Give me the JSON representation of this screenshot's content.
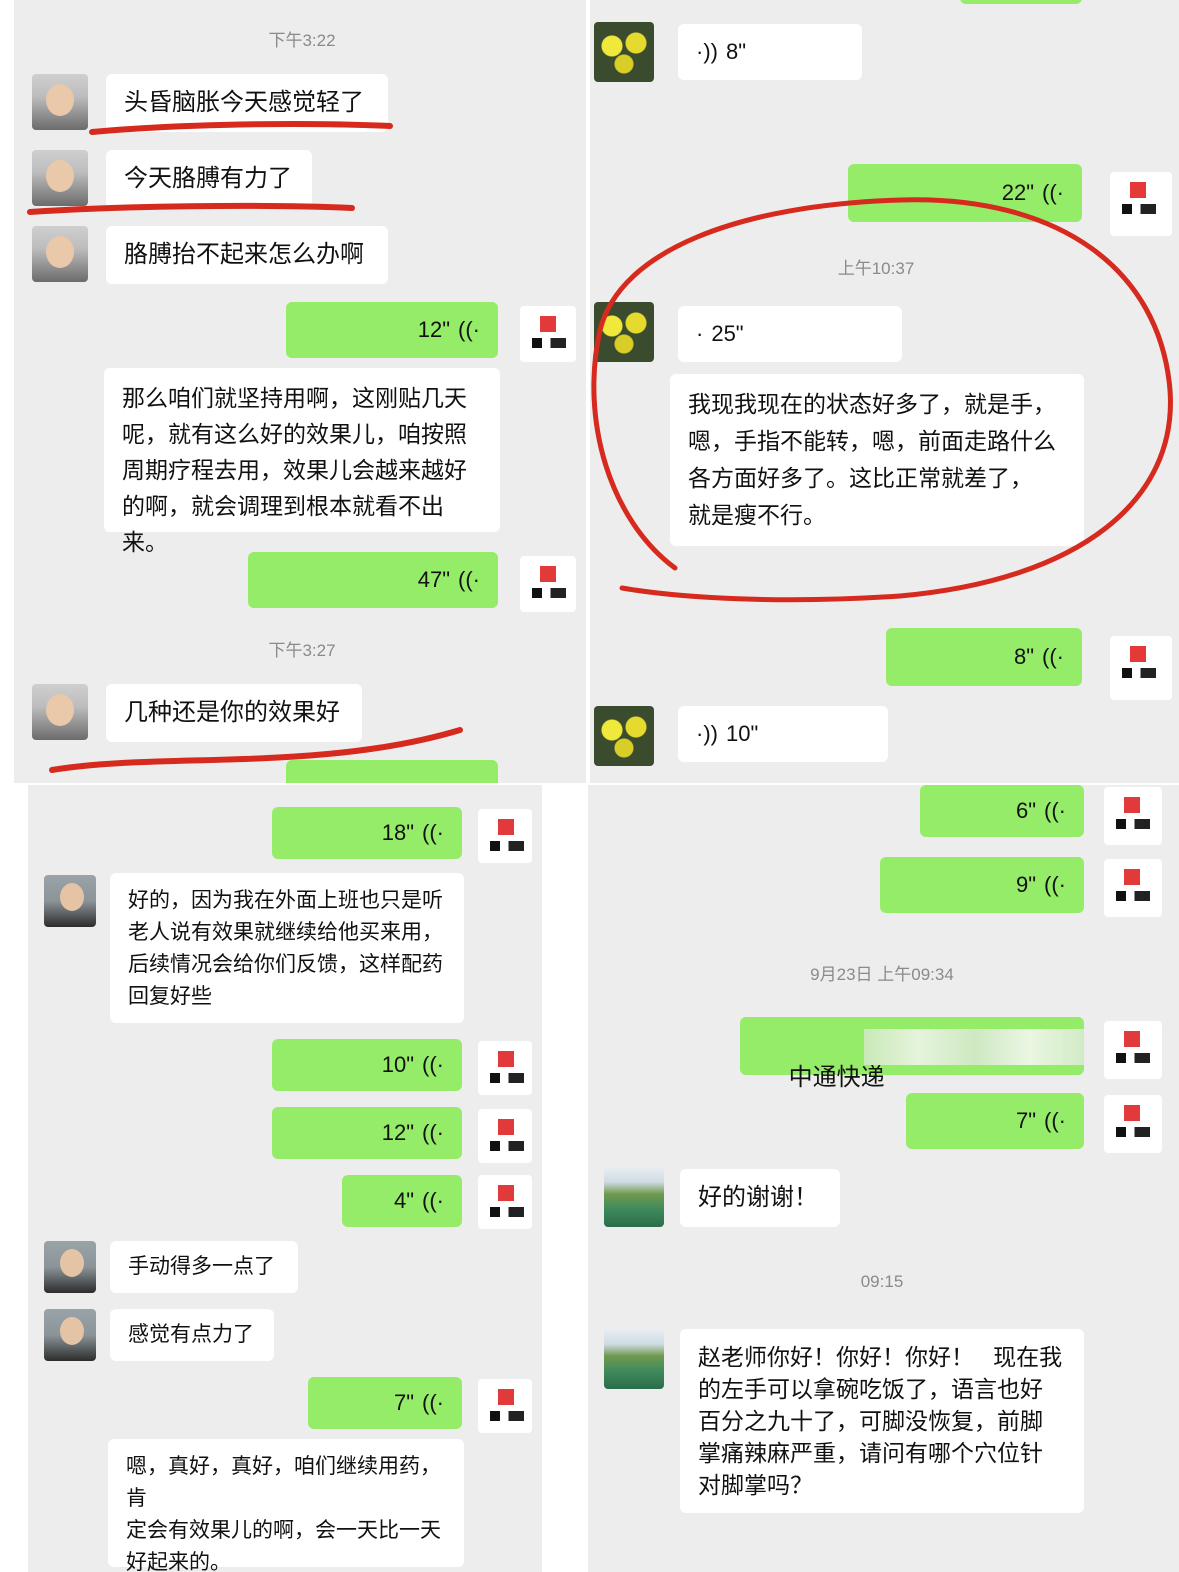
{
  "panel_tl": {
    "ts1": "下午3:22",
    "msg1": "头昏脑胀今天感觉轻了",
    "msg2": "今天胳膊有力了",
    "msg3": "胳膊抬不起来怎么办啊",
    "voice1": "12\"",
    "reply1": "那么咱们就坚持用啊，这刚贴几天\n呢，就有这么好的效果儿，咱按照\n周期疗程去用，效果儿会越来越好\n的啊，就会调理到根本就看不出来。",
    "voice2": "47\"",
    "ts2": "下午3:27",
    "msg4": "几种还是你的效果好"
  },
  "panel_tr": {
    "voice_in1": "8\"",
    "voice_out1": "22\"",
    "ts1": "上午10:37",
    "voice_in2": "25\"",
    "transcript": "我现我现在的状态好多了，就是手，\n嗯，手指不能转，嗯，前面走路什么\n各方面好多了。这比正常就差了，\n就是瘦不行。",
    "voice_out2": "8\"",
    "voice_in3": "10\""
  },
  "panel_bl": {
    "voice1": "18\"",
    "msg1": "好的，因为我在外面上班也只是听\n老人说有效果就继续给他买来用，\n后续情况会给你们反馈，这样配药\n回复好些",
    "voice2": "10\"",
    "voice3": "12\"",
    "voice4": "4\"",
    "msg2": "手动得多一点了",
    "msg3": "感觉有点力了",
    "voice5": "7\"",
    "reply": "嗯，真好，真好，咱们继续用药，肯\n定会有效果儿的啊，会一天比一天\n好起来的。"
  },
  "panel_br": {
    "voice1": "6\"",
    "voice2": "9\"",
    "ts1": "9月23日 上午09:34",
    "express": "中通快递",
    "voice3": "7\"",
    "msg1": "好的谢谢！",
    "ts2": "09:15",
    "msg2": "赵老师你好！你好！你好！   现在我\n的左手可以拿碗吃饭了，语言也好\n百分之九十了，可脚没恢复，前脚\n掌痛辣麻严重，请问有哪个穴位针\n对脚掌吗？"
  },
  "icons": {
    "voice_out": "voice-wave-icon",
    "voice_in": "voice-wave-icon"
  },
  "colors": {
    "bubble_green": "#95ec69",
    "bubble_white": "#ffffff",
    "chat_bg": "#ededed",
    "annotation_red": "#d62a1e"
  }
}
